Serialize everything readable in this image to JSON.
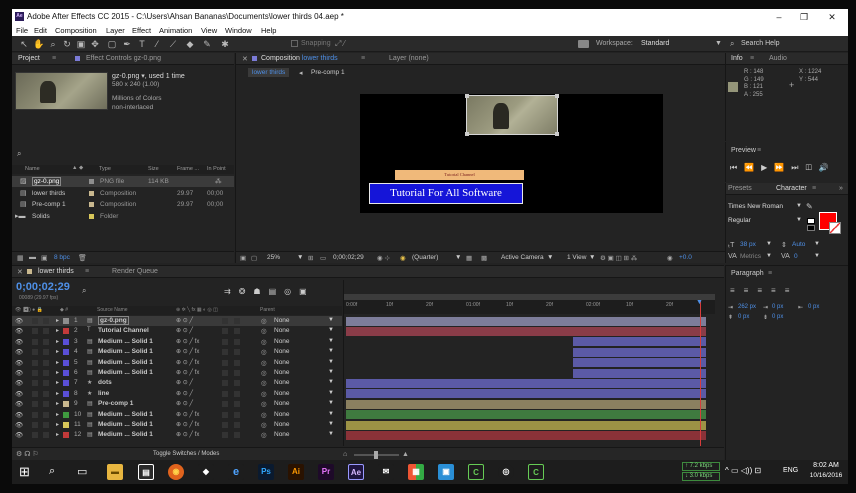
{
  "window": {
    "app_icon": "Ae",
    "title": "Adobe After Effects CC 2015 - C:\\Users\\Ahsan Bananas\\Documents\\lower thirds 04.aep *"
  },
  "menu": [
    "File",
    "Edit",
    "Composition",
    "Layer",
    "Effect",
    "Animation",
    "View",
    "Window",
    "Help"
  ],
  "toolbar": {
    "snapping": "Snapping",
    "workspace_label": "Workspace:",
    "workspace_value": "Standard",
    "search_placeholder": "Search Help"
  },
  "project": {
    "tab_project": "Project",
    "tab_effect_controls": "Effect Controls gz-0.png",
    "preview_name": "gz-0.png",
    "preview_used": ", used 1 time",
    "preview_size": "580 x 240 (1.00)",
    "preview_colors": "Millions of Colors",
    "preview_interlace": "non-interlaced",
    "search_icon": "⌕",
    "columns": [
      "Name",
      "Type",
      "Size",
      "Frame ...",
      "In Point"
    ],
    "items": [
      {
        "name": "gz-0.png",
        "type": "PNG file",
        "size": "114 KB",
        "frame": "",
        "color": "#8e8e8e"
      },
      {
        "name": "lower thirds",
        "type": "Composition",
        "size": "",
        "frame": "29.97",
        "inpoint": "00;00",
        "color": "#c9b88f"
      },
      {
        "name": "Pre-comp 1",
        "type": "Composition",
        "size": "",
        "frame": "29.97",
        "inpoint": "00;00",
        "color": "#c9b88f"
      },
      {
        "name": "Solids",
        "type": "Folder",
        "size": "",
        "frame": "",
        "color": "#d8c75a"
      }
    ],
    "bpc": "8 bpc"
  },
  "composition": {
    "tab": "Composition",
    "tab_name": "lower thirds",
    "tab_layer": "Layer (none)",
    "crumb_active": "lower thirds",
    "crumb_other": "Pre-comp 1",
    "channel_label": "Tutorial Channel",
    "main_text": "Tutorial For All Software",
    "zoom": "25%",
    "timecode": "0;00;02;29",
    "quality": "(Quarter)",
    "camera": "Active Camera",
    "view": "1 View",
    "exposure": "+0.0"
  },
  "info": {
    "tab_info": "Info",
    "tab_audio": "Audio",
    "r": "R : 148",
    "g": "G : 149",
    "b": "B : 121",
    "a": "A : 255",
    "x": "X : 1224",
    "y": "Y : 544",
    "swatch": "#949579"
  },
  "preview": {
    "title": "Preview"
  },
  "character": {
    "tab_presets": "Presets",
    "tab_character": "Character",
    "font": "Times New Roman",
    "style": "Regular",
    "size": "38 px",
    "leading": "Auto",
    "metrics": "Metrics",
    "tracking": "0",
    "fill_color": "#ff0000"
  },
  "paragraph": {
    "title": "Paragraph",
    "indent1": "262 px",
    "indent2": "0 px",
    "indent3": "0 px",
    "space1": "0 px",
    "space2": "0 px"
  },
  "timeline": {
    "tab": "lower thirds",
    "tab_render": "Render Queue",
    "timecode": "0;00;02;29",
    "frames": "00089 (29.97 fps)",
    "col_source": "Source Name",
    "col_parent": "Parent",
    "ruler": [
      "0:00f",
      "10f",
      "20f",
      "01:00f",
      "10f",
      "20f",
      "02:00f",
      "10f",
      "20f"
    ],
    "toggle": "Toggle Switches / Modes",
    "layers": [
      {
        "num": "1",
        "name": "gz-0.png",
        "color": "#8e8e8e",
        "parent": "None",
        "bar": "#7d7d9a",
        "start": 0
      },
      {
        "num": "2",
        "name": "Tutorial Channel",
        "color": "#c23a3a",
        "parent": "None",
        "bar": "#8a3c48",
        "start": 0
      },
      {
        "num": "3",
        "name": "Medium ... Solid 1",
        "color": "#5a4fd6",
        "parent": "None",
        "bar": "#5b5aa6",
        "start": 0.63
      },
      {
        "num": "4",
        "name": "Medium ... Solid 1",
        "color": "#5a4fd6",
        "parent": "None",
        "bar": "#5b5aa6",
        "start": 0.63
      },
      {
        "num": "5",
        "name": "Medium ... Solid 1",
        "color": "#5a4fd6",
        "parent": "None",
        "bar": "#5b5aa6",
        "start": 0.63
      },
      {
        "num": "6",
        "name": "Medium ... Solid 1",
        "color": "#5a4fd6",
        "parent": "None",
        "bar": "#5b5aa6",
        "start": 0.63
      },
      {
        "num": "7",
        "name": "dots",
        "color": "#5a4fd6",
        "parent": "None",
        "bar": "#5b5aa6",
        "start": 0
      },
      {
        "num": "8",
        "name": "line",
        "color": "#5a4fd6",
        "parent": "None",
        "bar": "#5b5aa6",
        "start": 0
      },
      {
        "num": "9",
        "name": "Pre-comp 1",
        "color": "#c9b88f",
        "parent": "None",
        "bar": "#8b8060",
        "start": 0
      },
      {
        "num": "10",
        "name": "Medium ... Solid 1",
        "color": "#3f9a3f",
        "parent": "None",
        "bar": "#3f7a3f",
        "start": 0
      },
      {
        "num": "11",
        "name": "Medium ... Solid 1",
        "color": "#d8c75a",
        "parent": "None",
        "bar": "#9c9245",
        "start": 0
      },
      {
        "num": "12",
        "name": "Medium ... Solid 1",
        "color": "#c23a3a",
        "parent": "None",
        "bar": "#8a3238",
        "start": 0
      }
    ]
  },
  "taskbar": {
    "net_up": "7.2 kbps",
    "net_down": "3.0 kbps",
    "lang": "ENG",
    "time": "8:02 AM",
    "date": "10/16/2016"
  }
}
